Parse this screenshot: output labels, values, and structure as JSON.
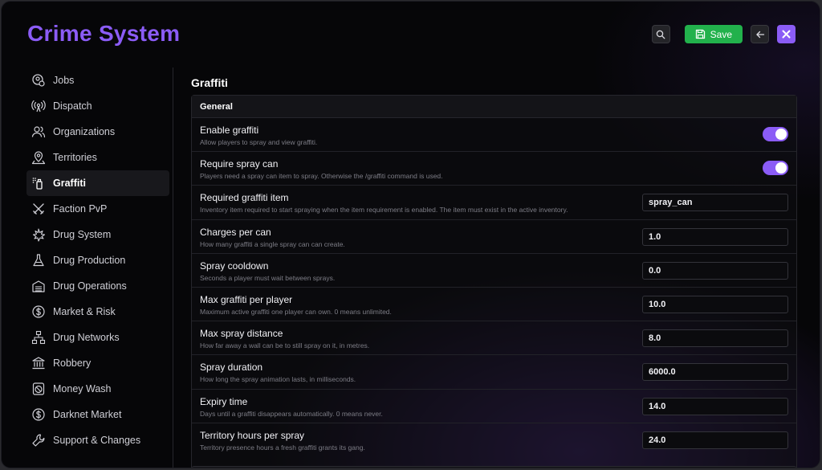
{
  "app": {
    "title": "Crime System"
  },
  "toolbar": {
    "save_label": "Save"
  },
  "sidebar": {
    "items": [
      {
        "label": "Jobs",
        "icon": "badge-pin-icon",
        "active": false
      },
      {
        "label": "Dispatch",
        "icon": "radio-tower-icon",
        "active": false
      },
      {
        "label": "Organizations",
        "icon": "users-icon",
        "active": false
      },
      {
        "label": "Territories",
        "icon": "map-pin-icon",
        "active": false
      },
      {
        "label": "Graffiti",
        "icon": "spray-can-icon",
        "active": true
      },
      {
        "label": "Faction PvP",
        "icon": "crossed-swords-icon",
        "active": false
      },
      {
        "label": "Drug System",
        "icon": "leaf-icon",
        "active": false
      },
      {
        "label": "Drug Production",
        "icon": "flask-icon",
        "active": false
      },
      {
        "label": "Drug Operations",
        "icon": "warehouse-icon",
        "active": false
      },
      {
        "label": "Market & Risk",
        "icon": "dollar-circle-icon",
        "active": false
      },
      {
        "label": "Drug Networks",
        "icon": "network-icon",
        "active": false
      },
      {
        "label": "Robbery",
        "icon": "bank-icon",
        "active": false
      },
      {
        "label": "Money Wash",
        "icon": "washing-machine-icon",
        "active": false
      },
      {
        "label": "Darknet Market",
        "icon": "dollar-circle-icon",
        "active": false
      },
      {
        "label": "Support & Changes",
        "icon": "wrench-icon",
        "active": false
      }
    ]
  },
  "main": {
    "title": "Graffiti",
    "section_title": "General",
    "settings": [
      {
        "label": "Enable graffiti",
        "desc": "Allow players to spray and view graffiti.",
        "type": "toggle",
        "value": true
      },
      {
        "label": "Require spray can",
        "desc": "Players need a spray can item to spray. Otherwise the /graffiti command is used.",
        "type": "toggle",
        "value": true
      },
      {
        "label": "Required graffiti item",
        "desc": "Inventory item required to start spraying when the item requirement is enabled. The item must exist in the active inventory.",
        "type": "text",
        "value": "spray_can"
      },
      {
        "label": "Charges per can",
        "desc": "How many graffiti a single spray can can create.",
        "type": "number",
        "value": "1.0"
      },
      {
        "label": "Spray cooldown",
        "desc": "Seconds a player must wait between sprays.",
        "type": "number",
        "value": "0.0"
      },
      {
        "label": "Max graffiti per player",
        "desc": "Maximum active graffiti one player can own. 0 means unlimited.",
        "type": "number",
        "value": "10.0"
      },
      {
        "label": "Max spray distance",
        "desc": "How far away a wall can be to still spray on it, in metres.",
        "type": "number",
        "value": "8.0"
      },
      {
        "label": "Spray duration",
        "desc": "How long the spray animation lasts, in milliseconds.",
        "type": "number",
        "value": "6000.0"
      },
      {
        "label": "Expiry time",
        "desc": "Days until a graffiti disappears automatically. 0 means never.",
        "type": "number",
        "value": "14.0"
      },
      {
        "label": "Territory hours per spray",
        "desc": "Territory presence hours a fresh graffiti grants its gang.",
        "type": "number",
        "value": "24.0"
      }
    ]
  },
  "colors": {
    "accent": "#8b5cf6",
    "save": "#22b14c",
    "background": "#060608"
  }
}
